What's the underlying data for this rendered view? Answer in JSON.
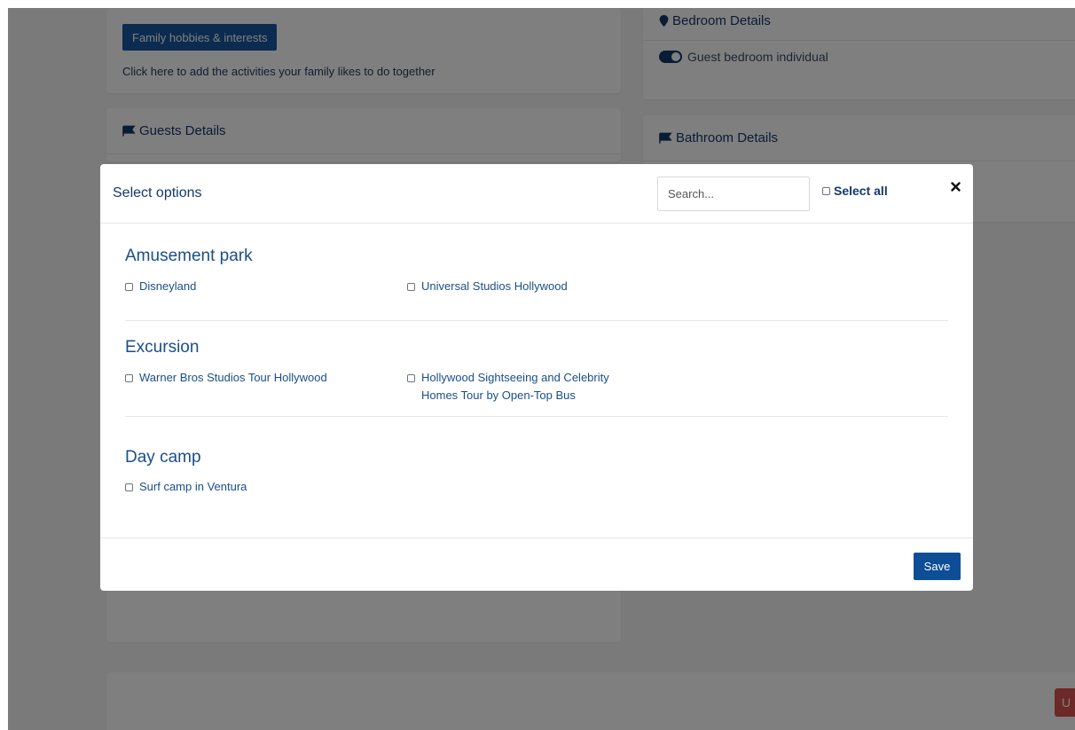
{
  "background": {
    "family_hobbies_button": "Family hobbies & interests",
    "family_hobbies_hint": "Click here to add the activities your family likes to do together",
    "guests_details_title": "Guests Details",
    "bedroom_details_title": "Bedroom Details",
    "guest_bedroom_toggle_label": "Guest bedroom individual",
    "bathroom_details_title": "Bathroom Details",
    "partial_button_label": "U"
  },
  "modal": {
    "title": "Select options",
    "search_placeholder": "Search...",
    "select_all_label": "Select all",
    "close_icon": "close-icon",
    "sections": [
      {
        "title": "Amusement park",
        "options": [
          "Disneyland",
          "Universal Studios Hollywood"
        ]
      },
      {
        "title": "Excursion",
        "options": [
          "Warner Bros Studios Tour Hollywood",
          "Hollywood Sightseeing and Celebrity Homes Tour by Open-Top Bus"
        ]
      },
      {
        "title": "Day camp",
        "options": [
          "Surf camp in Ventura"
        ]
      }
    ],
    "save_label": "Save"
  },
  "colors": {
    "primary": "#0d4e96",
    "heading": "#13396b",
    "link": "#1a4e8a",
    "danger": "#d9534f"
  }
}
